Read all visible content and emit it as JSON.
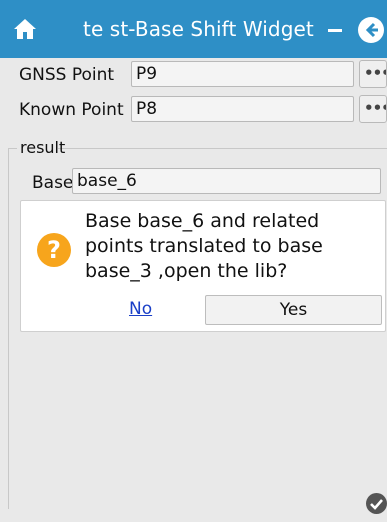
{
  "window": {
    "title": "te st-Base Shift Widget",
    "icons": [
      "home-icon",
      "minimize-icon",
      "back-icon"
    ],
    "titlebar_color": "#2e8fc6"
  },
  "form": {
    "gnss_point": {
      "label": "GNSS Point",
      "value": "P9",
      "more_label": "•••"
    },
    "known_point": {
      "label": "Known Point",
      "value": "P8",
      "more_label": "•••"
    }
  },
  "result": {
    "group_label": "result",
    "base": {
      "label": "Base",
      "value": "base_6"
    }
  },
  "dialog": {
    "icon": "question-icon",
    "icon_glyph": "?",
    "message": "Base base_6 and related points translated to base base_3 ,open the lib?",
    "no_label": "No",
    "yes_label": "Yes",
    "icon_color": "#f7a51c",
    "link_color": "#1a3fc7"
  },
  "footer": {
    "icon": "check-icon"
  }
}
